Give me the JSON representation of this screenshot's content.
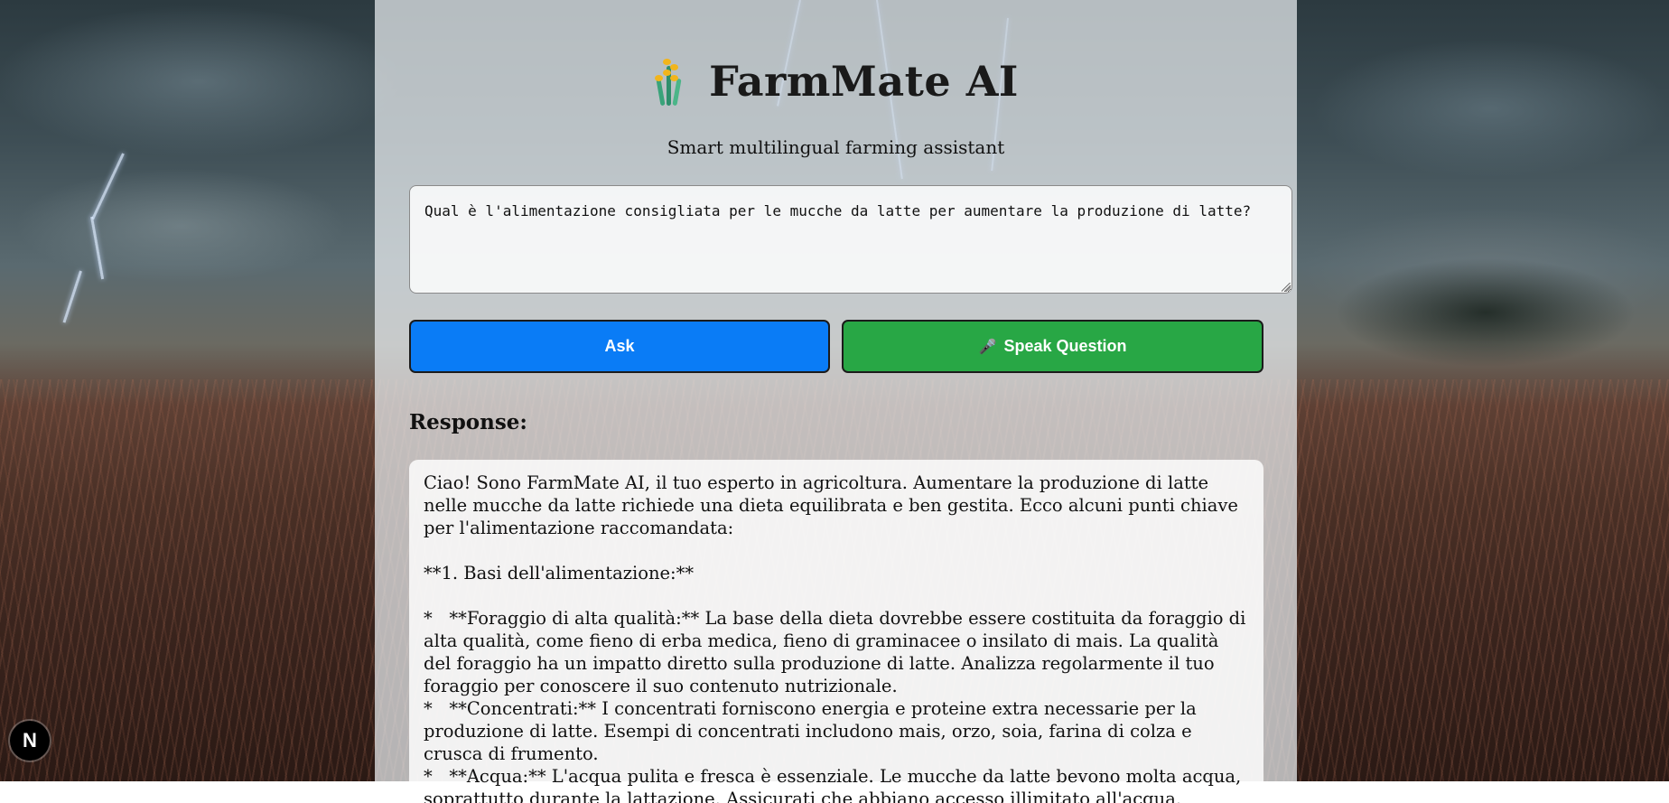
{
  "app": {
    "title": "FarmMate AI",
    "subtitle": "Smart multilingual farming assistant",
    "logo_icon": "wheat-icon",
    "brand_colors": {
      "ask": "#0a7cf6",
      "speak": "#28a745"
    }
  },
  "question": {
    "value": "Qual è l'alimentazione consigliata per le mucche da latte per aumentare la produzione di latte?"
  },
  "buttons": {
    "ask_label": "Ask",
    "speak_label": "Speak Question",
    "speak_icon": "microphone-icon",
    "speak_icon_glyph": "🎤"
  },
  "response": {
    "label": "Response:",
    "text": "Ciao! Sono FarmMate AI, il tuo esperto in agricoltura. Aumentare la produzione di latte nelle mucche da latte richiede una dieta equilibrata e ben gestita. Ecco alcuni punti chiave per l'alimentazione raccomandata:\n\n**1. Basi dell'alimentazione:**\n\n*   **Foraggio di alta qualità:** La base della dieta dovrebbe essere costituita da foraggio di alta qualità, come fieno di erba medica, fieno di graminacee o insilato di mais. La qualità del foraggio ha un impatto diretto sulla produzione di latte. Analizza regolarmente il tuo foraggio per conoscere il suo contenuto nutrizionale.\n*   **Concentrati:** I concentrati forniscono energia e proteine extra necessarie per la produzione di latte. Esempi di concentrati includono mais, orzo, soia, farina di colza e crusca di frumento.\n*   **Acqua:** L'acqua pulita e fresca è essenziale. Le mucche da latte bevono molta acqua, soprattutto durante la lattazione. Assicurati che abbiano accesso illimitato all'acqua."
  },
  "devtools": {
    "badge_letter": "N",
    "badge_icon": "nextjs-icon"
  }
}
